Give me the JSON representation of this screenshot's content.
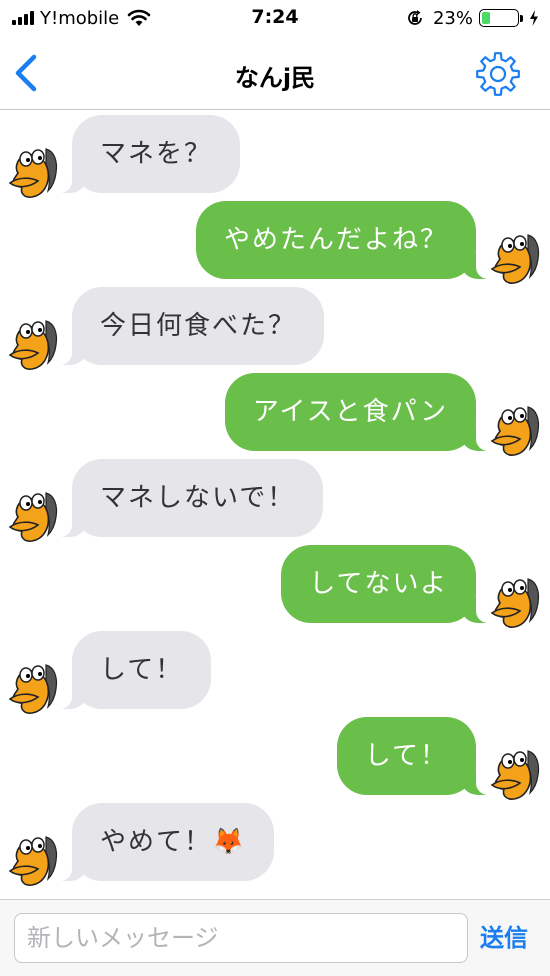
{
  "status_bar": {
    "carrier": "Y!mobile",
    "time": "7:24",
    "battery_percent_label": "23%",
    "battery_level": 0.23,
    "icons": [
      "signal-icon",
      "wifi-icon",
      "orientation-lock-icon",
      "battery-icon",
      "charging-icon"
    ]
  },
  "nav": {
    "title": "なんj民",
    "back_icon": "chevron-left-icon",
    "settings_icon": "gear-icon"
  },
  "messages": [
    {
      "direction": "incoming",
      "text": "マネを？"
    },
    {
      "direction": "outgoing",
      "text": "やめたんだよね？"
    },
    {
      "direction": "incoming",
      "text": "今日何食べた？"
    },
    {
      "direction": "outgoing",
      "text": "アイスと食パン"
    },
    {
      "direction": "incoming",
      "text": "マネしないで！"
    },
    {
      "direction": "outgoing",
      "text": "してないよ"
    },
    {
      "direction": "incoming",
      "text": "して！"
    },
    {
      "direction": "outgoing",
      "text": "して！"
    },
    {
      "direction": "incoming",
      "text": "やめて！🦊"
    }
  ],
  "composer": {
    "placeholder": "新しいメッセージ",
    "value": "",
    "send_label": "送信"
  },
  "colors": {
    "incoming_bubble": "#e5e5ea",
    "outgoing_bubble": "#6abf4b",
    "accent": "#1a7ef0",
    "battery": "#4cd964"
  }
}
